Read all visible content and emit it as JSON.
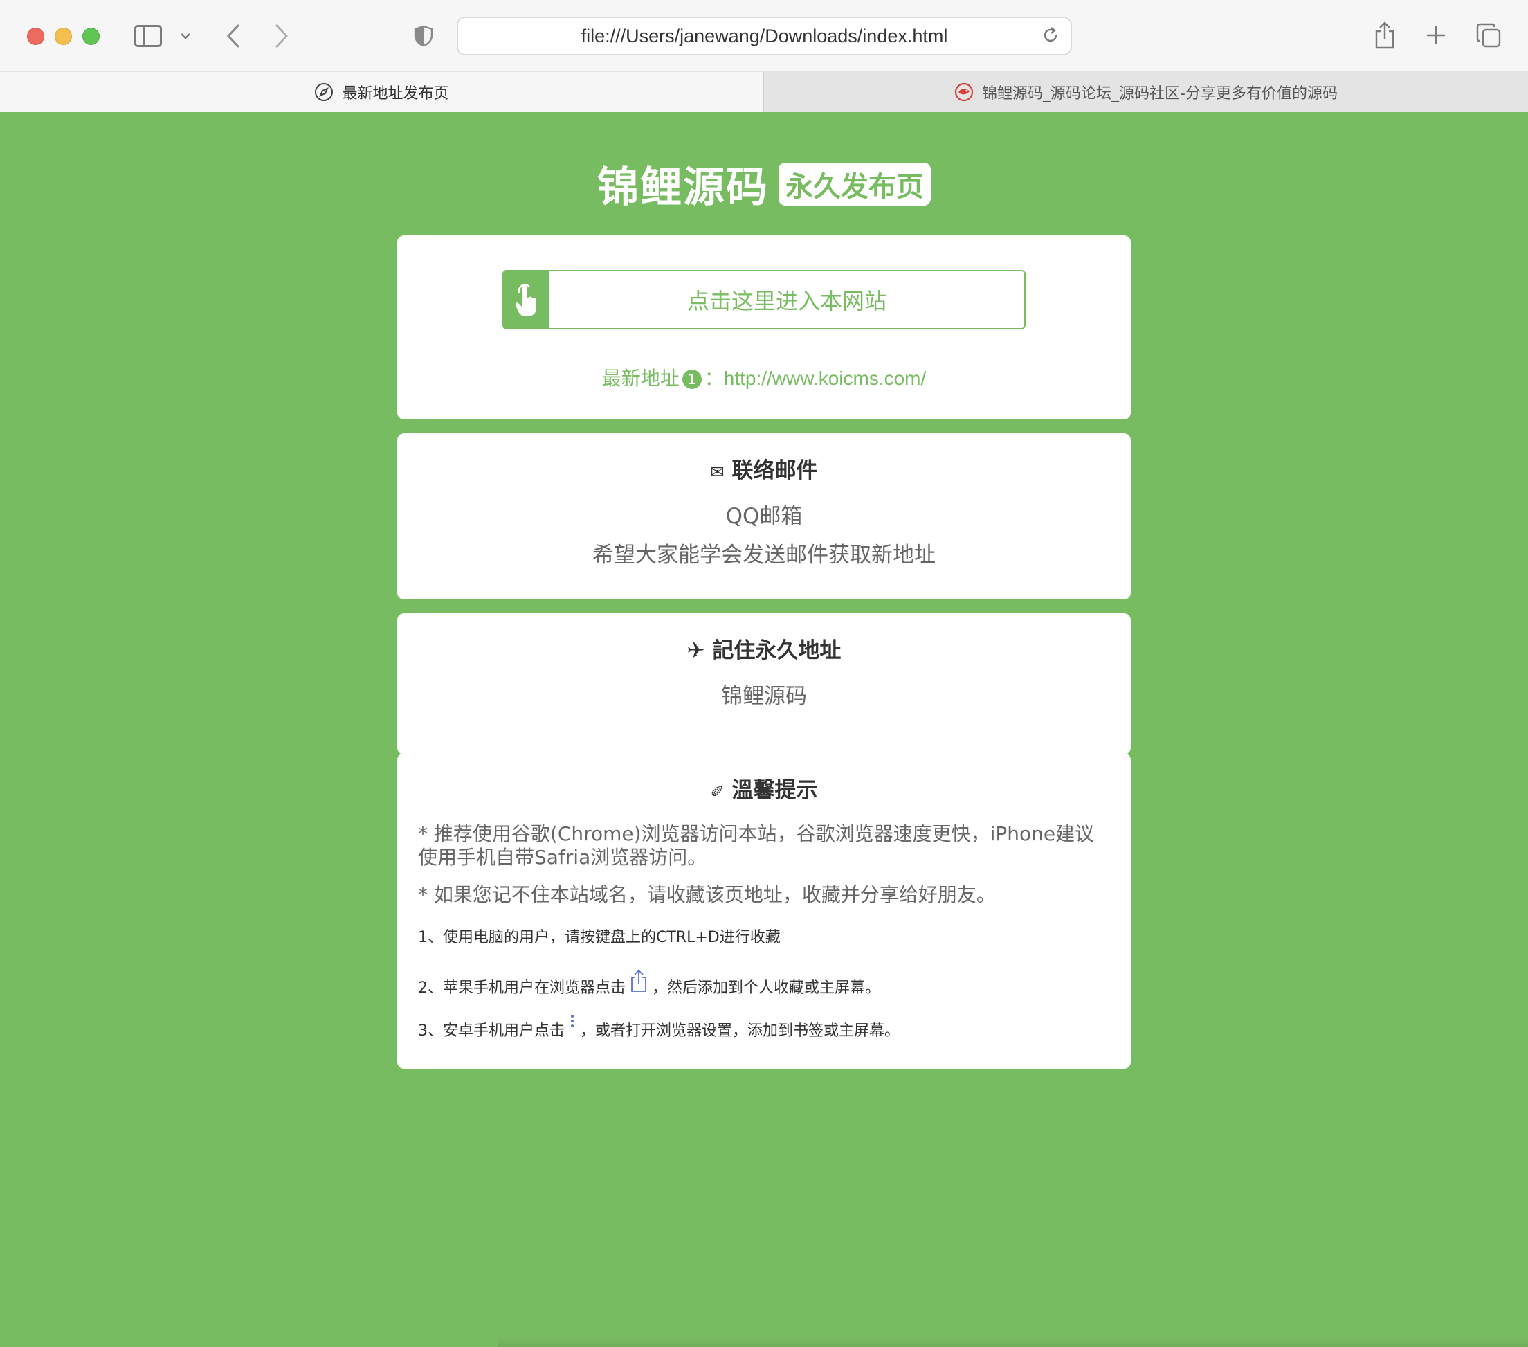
{
  "browser": {
    "address": "file:///Users/janewang/Downloads/index.html",
    "tabs": [
      {
        "title": "最新地址发布页",
        "icon": "compass-icon",
        "active": true
      },
      {
        "title": "锦鲤源码_源码论坛_源码社区-分享更多有价值的源码",
        "icon": "koi-logo-icon",
        "active": false
      }
    ]
  },
  "colors": {
    "accent": "#78bc62",
    "text": "#333333",
    "muted": "#666666"
  },
  "hero": {
    "title": "锦鲤源码",
    "badge": "永久发布页"
  },
  "entry": {
    "button_label": "点击这里进入本网站",
    "address_label": "最新地址",
    "address_number": "1",
    "address_sep": "：",
    "address_url": "http://www.koicms.com/"
  },
  "contact": {
    "title": "联络邮件",
    "icon": "mail-icon",
    "line1": "QQ邮箱",
    "line2": "希望大家能学会发送邮件获取新地址"
  },
  "remember": {
    "title": "記住永久地址",
    "icon": "airplane-icon",
    "line1": "锦鲤源码"
  },
  "tips": {
    "title": "溫馨提示",
    "icon": "leaf-icon",
    "tip1": "* 推荐使用谷歌(Chrome)浏览器访问本站，谷歌浏览器速度更快，iPhone建议使用手机自带Safria浏览器访问。",
    "tip2": "* 如果您记不住本站域名，请收藏该页地址，收藏并分享给好朋友。",
    "step1": "1、使用电脑的用户，请按键盘上的CTRL+D进行收藏",
    "step2_a": "2、苹果手机用户在浏览器点击",
    "step2_b": "，然后添加到个人收藏或主屏幕。",
    "step3_a": "3、安卓手机用户点击",
    "step3_b": "，或者打开浏览器设置，添加到书签或主屏幕。"
  }
}
